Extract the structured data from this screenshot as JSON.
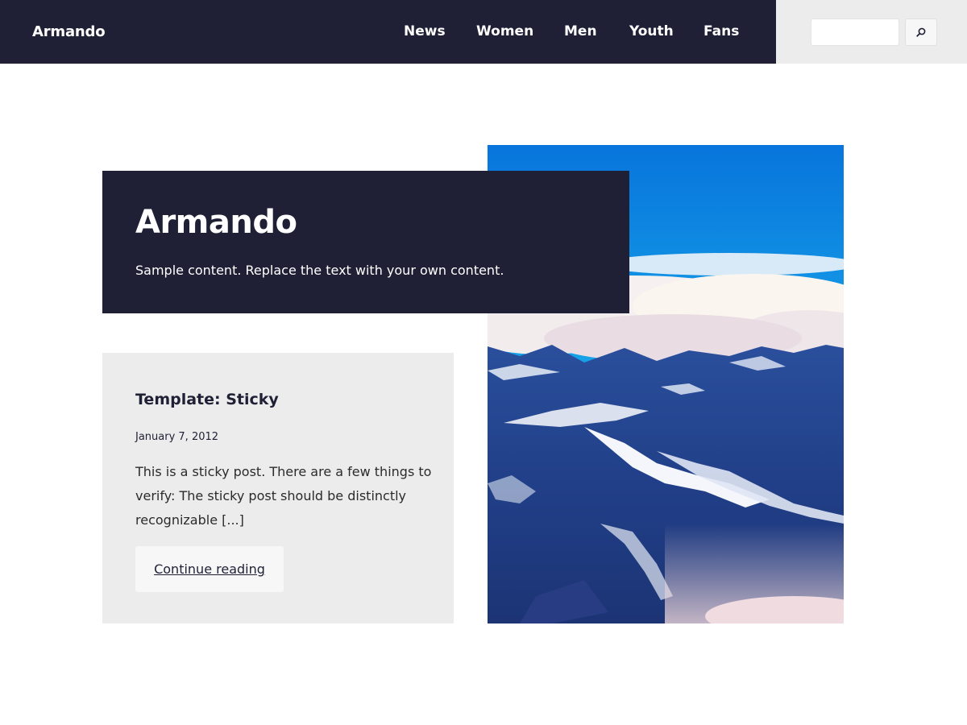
{
  "header": {
    "site_title": "Armando",
    "nav": [
      "News",
      "Women",
      "Men",
      "Youth",
      "Fans"
    ],
    "search": {
      "value": "",
      "placeholder": ""
    }
  },
  "hero": {
    "title": "Armando",
    "subtitle": "Sample content. Replace the text with your own content."
  },
  "post": {
    "title": "Template: Sticky",
    "date": "January 7, 2012",
    "excerpt": "This is a sticky post. There are a few things to verify: The sticky post should be distinctly recognizable [...]",
    "continue_label": "Continue reading"
  },
  "icons": {
    "search": "search-icon"
  },
  "colors": {
    "header_bg": "#1f2035",
    "search_area_bg": "#ececec",
    "card_bg": "#ececec",
    "title_box_bg": "#1f2035"
  }
}
